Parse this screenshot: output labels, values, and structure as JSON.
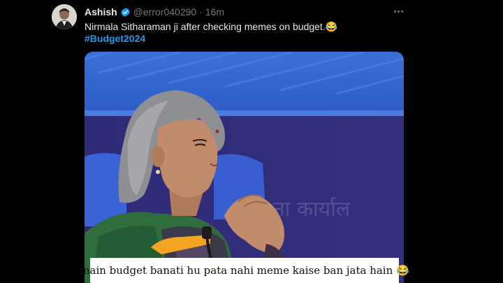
{
  "tweet": {
    "author": {
      "display_name": "Ashish",
      "handle": "@error040290",
      "verified_icon": "verified-badge-icon"
    },
    "separator": "·",
    "time": "16m",
    "text": "Nirmala Sitharaman ji after checking memes on budget.😂",
    "hashtag": "#Budget2024",
    "more_icon": "more-options-icon",
    "media": {
      "caption": "main budget banati hu pata nahi meme kaise ban jata hain 😂",
      "backdrop_text": "ना कार्याल"
    }
  },
  "colors": {
    "background": "#000000",
    "primary_text": "#e7e9ea",
    "secondary_text": "#71767b",
    "link": "#1d9bf0"
  }
}
